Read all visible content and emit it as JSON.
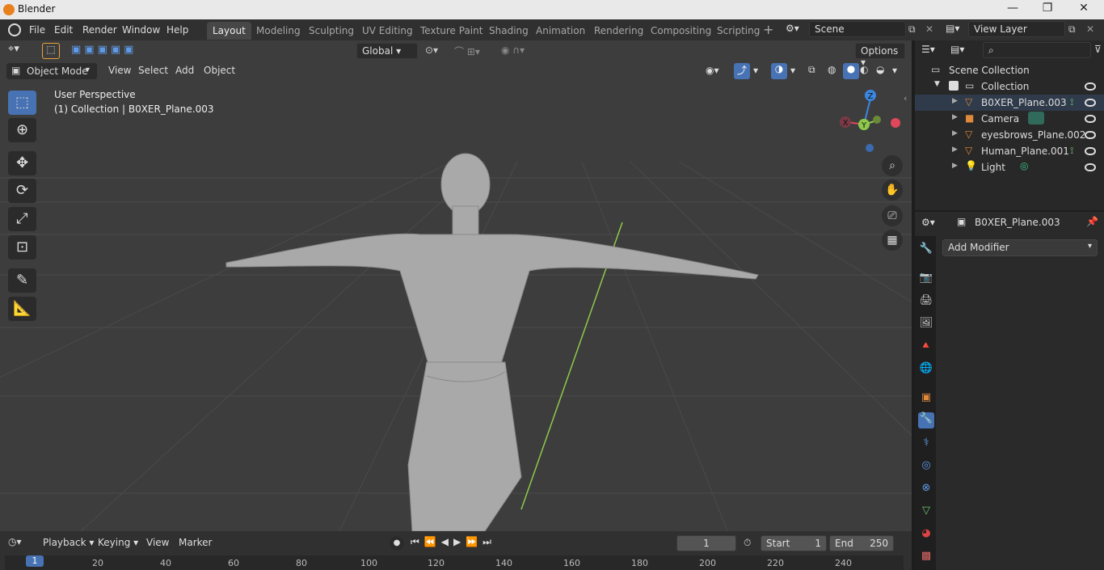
{
  "app": {
    "title": "Blender"
  },
  "menu": [
    "File",
    "Edit",
    "Render",
    "Window",
    "Help"
  ],
  "workspaces": [
    {
      "label": "Layout",
      "active": true
    },
    {
      "label": "Modeling"
    },
    {
      "label": "Sculpting"
    },
    {
      "label": "UV Editing"
    },
    {
      "label": "Texture Paint"
    },
    {
      "label": "Shading"
    },
    {
      "label": "Animation"
    },
    {
      "label": "Rendering"
    },
    {
      "label": "Compositing"
    },
    {
      "label": "Scripting"
    }
  ],
  "scene": {
    "name": "Scene"
  },
  "view_layer": {
    "name": "View Layer"
  },
  "toolheader": {
    "orientation": "Global",
    "options_label": "Options"
  },
  "viewport_header": {
    "mode": "Object Mode",
    "view": "View",
    "select": "Select",
    "add": "Add",
    "object": "Object"
  },
  "viewport": {
    "perspective_label": "User Perspective",
    "collection_label": "(1) Collection | B0XER_Plane.003"
  },
  "gizmo": {
    "x": "X",
    "y": "Y",
    "z": "Z"
  },
  "outliner": {
    "scene_collection": "Scene Collection",
    "collection": "Collection",
    "items": [
      {
        "name": "B0XER_Plane.003",
        "icon": "mesh-icon"
      },
      {
        "name": "Camera",
        "icon": "camera-icon"
      },
      {
        "name": "eyesbrows_Plane.002",
        "icon": "mesh-icon"
      },
      {
        "name": "Human_Plane.001",
        "icon": "mesh-icon"
      },
      {
        "name": "Light",
        "icon": "light-icon"
      }
    ]
  },
  "properties": {
    "object_name": "B0XER_Plane.003",
    "add_modifier": "Add Modifier"
  },
  "timeline": {
    "playback": "Playback",
    "keying": "Keying",
    "view": "View",
    "marker": "Marker",
    "current_frame": "1",
    "start_label": "Start",
    "start": "1",
    "end_label": "End",
    "end": "250",
    "ticks": [
      "1",
      "20",
      "40",
      "60",
      "80",
      "100",
      "120",
      "140",
      "160",
      "180",
      "200",
      "220",
      "240"
    ]
  },
  "colors": {
    "accent": "#4772b3",
    "title_bg": "#e9e9e9",
    "viewport_bg": "#3d3d3d",
    "mesh_orange": "#e0893a",
    "y_axis": "#8ec94b",
    "x_axis": "#e0475a",
    "z_axis": "#3b86e0"
  }
}
